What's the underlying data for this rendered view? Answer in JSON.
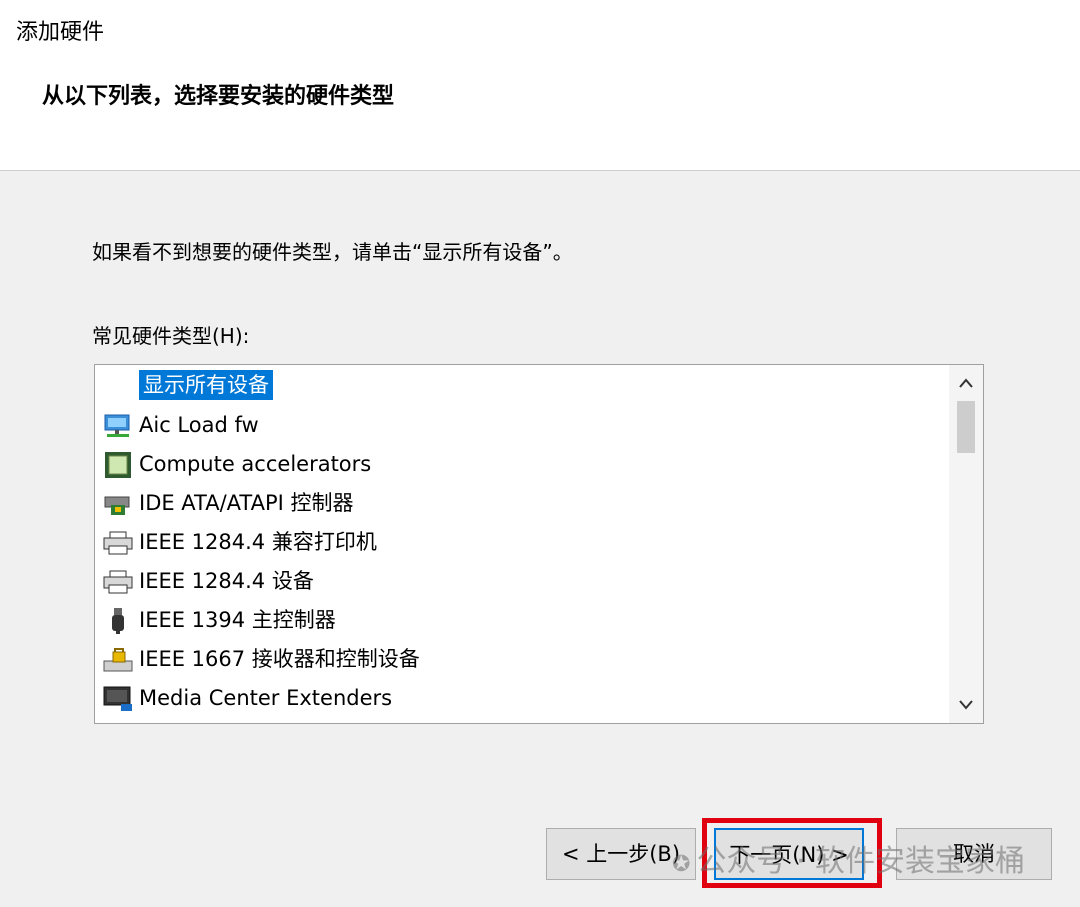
{
  "window": {
    "title": "添加硬件",
    "header": "从以下列表，选择要安装的硬件类型"
  },
  "main": {
    "instruction": "如果看不到想要的硬件类型，请单击“显示所有设备”。",
    "list_label": "常见硬件类型(H):",
    "items": [
      {
        "label": "显示所有设备",
        "icon": "none",
        "selected": true
      },
      {
        "label": "Aic Load fw",
        "icon": "network-computer-icon"
      },
      {
        "label": "Compute accelerators",
        "icon": "chip-icon"
      },
      {
        "label": "IDE ATA/ATAPI 控制器",
        "icon": "ide-controller-icon"
      },
      {
        "label": "IEEE 1284.4 兼容打印机",
        "icon": "printer-icon"
      },
      {
        "label": "IEEE 1284.4 设备",
        "icon": "printer-icon"
      },
      {
        "label": "IEEE 1394 主控制器",
        "icon": "usb-plug-icon"
      },
      {
        "label": "IEEE 1667 接收器和控制设备",
        "icon": "lock-drive-icon"
      },
      {
        "label": "Media Center Extenders",
        "icon": "monitor-icon"
      }
    ]
  },
  "scrollbar": {
    "up": "^",
    "down": "v"
  },
  "footer": {
    "back_label": "< 上一步(B)",
    "next_label": "下一页(N) >",
    "cancel_label": "取消"
  },
  "watermark": {
    "text": "公众号 · 软件安装宝家桶"
  },
  "colors": {
    "selection": "#0078d7",
    "highlight": "#e00010"
  }
}
